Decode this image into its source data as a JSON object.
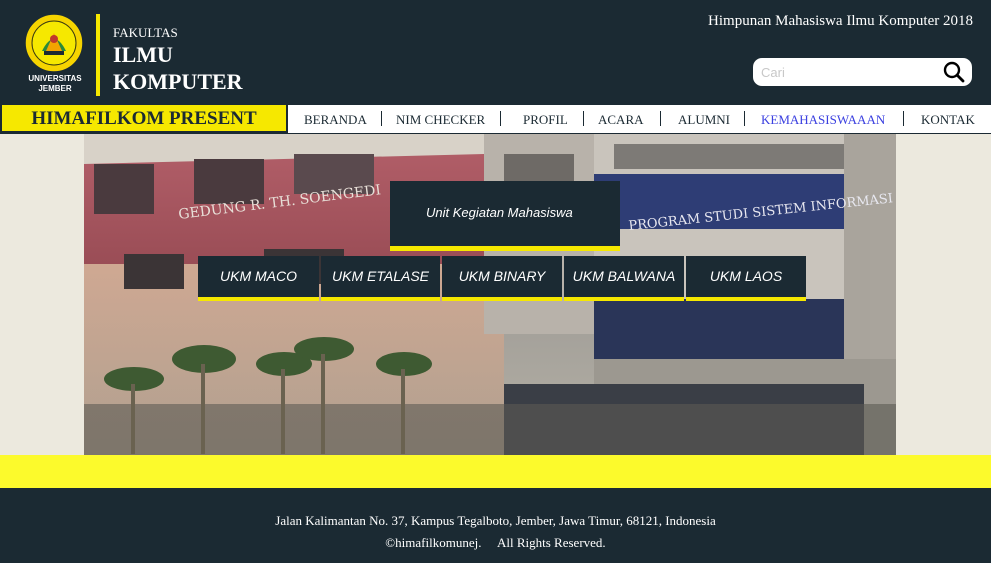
{
  "header": {
    "logo_text_line1": "UNIVERSITAS",
    "logo_text_line2": "JEMBER",
    "faculty_small": "FAKULTAS",
    "faculty_line1": "ILMU",
    "faculty_line2": "KOMPUTER",
    "org_title": "Himpunan Mahasiswa Ilmu Komputer 2018",
    "search_placeholder": "Cari"
  },
  "nav": {
    "banner": "HIMAFILKOM PRESENT",
    "items": [
      {
        "label": "BERANDA"
      },
      {
        "label": "NIM CHECKER"
      },
      {
        "label": "PROFIL"
      },
      {
        "label": "ACARA"
      },
      {
        "label": "ALUMNI"
      },
      {
        "label": "KEMAHASISWAAAN"
      },
      {
        "label": "KONTAK"
      }
    ],
    "active_index": 5
  },
  "hero": {
    "sign_left": "GEDUNG R. TH. SOENGEDI",
    "sign_right": "PROGRAM STUDI SISTEM INFORMASI",
    "ukm_title": "Unit Kegiatan Mahasiswa",
    "ukm_buttons": [
      {
        "label": "UKM MACO"
      },
      {
        "label": "UKM ETALASE"
      },
      {
        "label": "UKM BINARY"
      },
      {
        "label": "UKM BALWANA"
      },
      {
        "label": "UKM LAOS"
      }
    ]
  },
  "footer": {
    "address": "Jalan Kalimantan No. 37, Kampus Tegalboto, Jember, Jawa Timur, 68121, Indonesia",
    "copyright": "©himafilkomunej.     All Rights Reserved."
  },
  "colors": {
    "dark": "#1b2a33",
    "yellow": "#f6e800",
    "band_yellow": "#fcfa2c",
    "active_link": "#3b40e0"
  }
}
